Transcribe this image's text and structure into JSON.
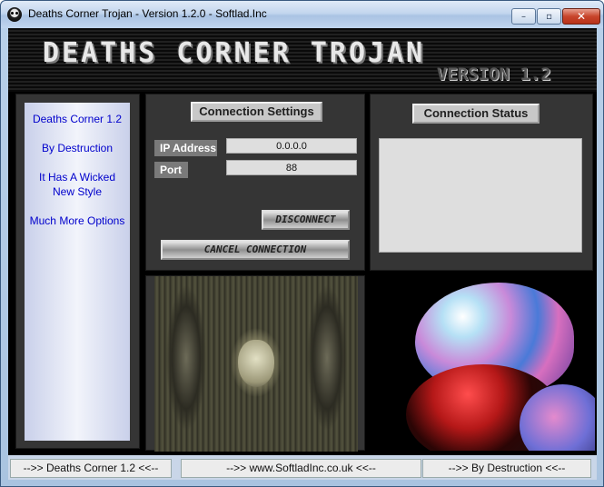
{
  "window": {
    "title": "Deaths Corner Trojan - Version 1.2.0 - Softlad.Inc",
    "controls": {
      "minimize": "–",
      "maximize": "▫",
      "close": "✕"
    }
  },
  "banner": {
    "title": "DEATHS CORNER TROJAN",
    "version": "VERSION 1.2"
  },
  "sidebar": {
    "items": [
      {
        "label": "Deaths Corner 1.2"
      },
      {
        "label": "By Destruction"
      },
      {
        "label": "It Has A Wicked New Style"
      },
      {
        "label": "Much More Options"
      }
    ]
  },
  "connection_settings": {
    "title": "Connection Settings",
    "ip_label": "IP Address",
    "ip_value": "0.0.0.0",
    "port_label": "Port",
    "port_value": "88",
    "disconnect_label": "DISCONNECT",
    "cancel_label": "CANCEL CONNECTION"
  },
  "connection_status": {
    "title": "Connection Status",
    "text": ""
  },
  "footer": {
    "links": [
      {
        "label": "-->> Deaths Corner 1.2 <<--"
      },
      {
        "label": "-->> www.SoftladInc.co.uk <<--"
      },
      {
        "label": "-->> By Destruction <<--"
      }
    ]
  },
  "colors": {
    "link_blue": "#0000cc",
    "panel_gray": "#353535",
    "field_bg": "#dedede"
  },
  "icons": {
    "app": "skull-icon"
  }
}
